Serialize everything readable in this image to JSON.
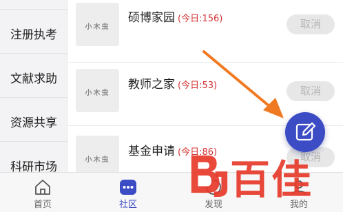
{
  "sidebar": {
    "items": [
      {
        "label": "注册执考"
      },
      {
        "label": "文献求助"
      },
      {
        "label": "资源共享"
      },
      {
        "label": "科研市场"
      }
    ]
  },
  "list": {
    "thumbnail_text": "小木虫",
    "rows": [
      {
        "title": "硕博家园",
        "count": "(今日:156)",
        "button": "取消"
      },
      {
        "title": "教师之家",
        "count": "(今日:53)",
        "button": "取消"
      },
      {
        "title": "基金申请",
        "count": "(今日:86)",
        "button": "取消"
      }
    ]
  },
  "tabbar": {
    "tabs": [
      {
        "label": "首页",
        "icon": "home-icon",
        "active": false
      },
      {
        "label": "社区",
        "icon": "community-icon",
        "active": true
      },
      {
        "label": "发现",
        "icon": "discover-icon",
        "active": false
      },
      {
        "label": "我的",
        "icon": "profile-icon",
        "active": false
      }
    ]
  },
  "fab": {
    "icon": "compose-icon"
  },
  "watermark": {
    "text": "百佳",
    "logo": "BJ"
  },
  "colors": {
    "accent": "#3b4cc4",
    "count_red": "#d43030",
    "arrow_orange": "#f07a22",
    "watermark_red": "#e63a2a"
  }
}
